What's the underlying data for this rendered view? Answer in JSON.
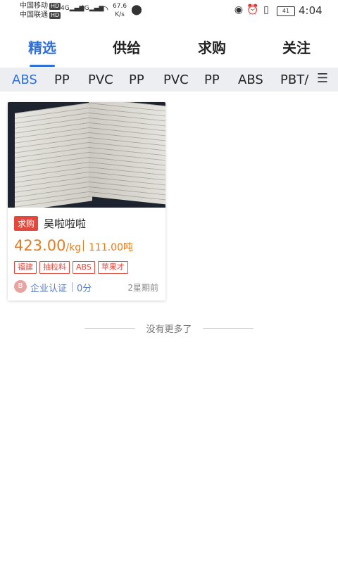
{
  "status_bar": {
    "carrier1": "中国移动",
    "carrier2": "中国联通",
    "hd": "HD",
    "net1": "4G",
    "net2": "4G",
    "speed_value": "67.6",
    "speed_unit": "K/s",
    "battery": "41",
    "time": "4:04"
  },
  "tabs": [
    "精选",
    "供给",
    "求购",
    "关注"
  ],
  "categories": [
    "ABS",
    "PP",
    "PVC",
    "PP",
    "PVC",
    "PP",
    "ABS",
    "PBT/"
  ],
  "listing": {
    "badge": "求购",
    "title": "吴啦啦啦",
    "price": "423.00",
    "price_unit": "/kg",
    "quantity": "111.00吨",
    "tags": [
      "福建",
      "抽粒料",
      "ABS",
      "苹果才"
    ],
    "avatar_letter": "B",
    "certification": "企业认证",
    "score": "0分",
    "posted": "2星期前"
  },
  "end_message": "没有更多了",
  "colors": {
    "accent": "#2f6fd6",
    "price": "#e57c1d",
    "badge": "#e4473b"
  }
}
